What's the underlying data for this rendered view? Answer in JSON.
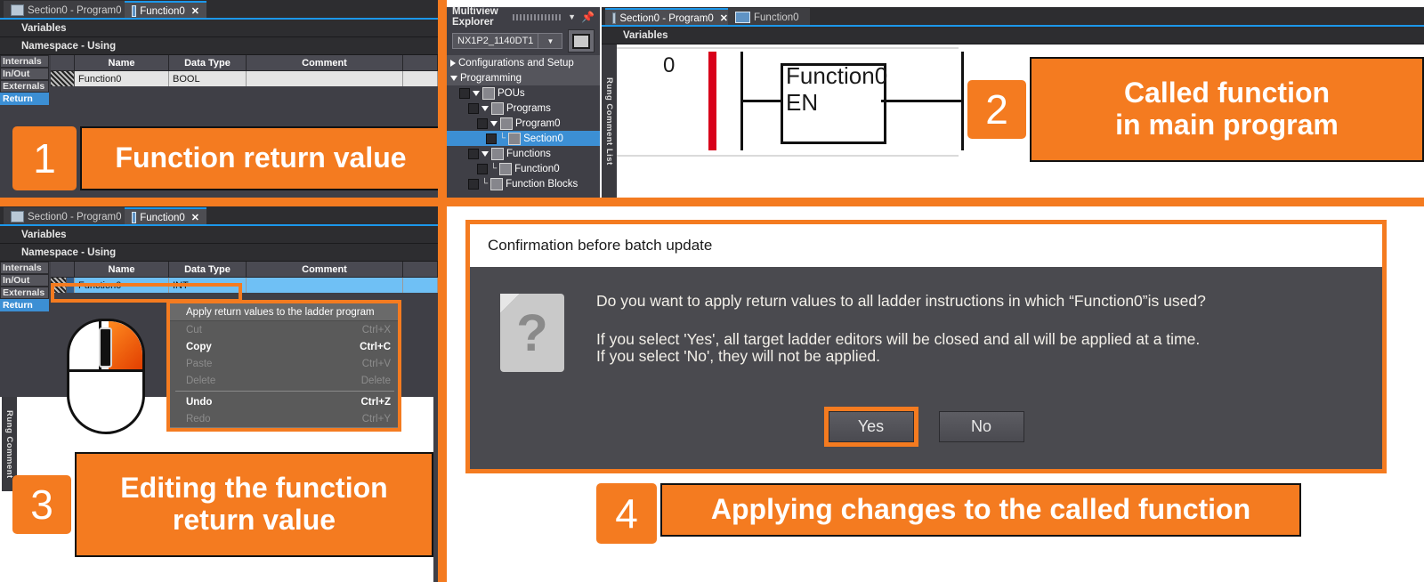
{
  "theme": {
    "accent": "#f47b20",
    "selection_blue": "#3c8fd4",
    "ide_background": "#3f3f46",
    "dialog_background": "#4a4a4f",
    "power_rail_red": "#d8001a"
  },
  "panel1": {
    "tabs": [
      {
        "label": "Section0 - Program0",
        "icon": "section-icon",
        "active": false,
        "closable": false
      },
      {
        "label": "Function0",
        "icon": "function-io-icon",
        "active": true,
        "closable": true,
        "close": "✕"
      }
    ],
    "bars": [
      {
        "label": "Variables"
      },
      {
        "label": "Namespace - Using"
      }
    ],
    "side_tabs": [
      {
        "label": "Internals",
        "selected": false
      },
      {
        "label": "In/Out",
        "selected": false
      },
      {
        "label": "Externals",
        "selected": false
      },
      {
        "label": "Return",
        "selected": true
      }
    ],
    "table": {
      "columns": [
        "",
        "Name",
        "Data Type",
        "Comment",
        ""
      ],
      "rows": [
        {
          "marker": "",
          "name": "Function0",
          "data_type": "BOOL",
          "comment": "",
          "extra": ""
        }
      ]
    }
  },
  "callout1": {
    "number": "1",
    "text": "Function return value"
  },
  "callout2": {
    "number": "2",
    "line1": "Called function",
    "line2": "in main program"
  },
  "callout3": {
    "number": "3",
    "line1": "Editing the function",
    "line2": "return value"
  },
  "callout4": {
    "number": "4",
    "text": "Applying changes to the called function"
  },
  "multiview": {
    "title": "Multiview Explorer",
    "icons": {
      "collapse": "chevron-down-icon",
      "pin": "pin-icon"
    },
    "device": "NX1P2_1140DT1",
    "device_dropdown_glyph": "▼",
    "tree": [
      {
        "label": "Configurations and Setup",
        "indent": 0,
        "expander": "right",
        "checkbox": false,
        "icon": false,
        "band": true,
        "selected": false,
        "elbow": false
      },
      {
        "label": "Programming",
        "indent": 0,
        "expander": "down",
        "checkbox": false,
        "icon": false,
        "band": true,
        "selected": false,
        "elbow": false
      },
      {
        "label": "POUs",
        "indent": 1,
        "expander": "down",
        "checkbox": true,
        "icon": true,
        "band": false,
        "selected": false,
        "elbow": false
      },
      {
        "label": "Programs",
        "indent": 2,
        "expander": "down",
        "checkbox": true,
        "icon": true,
        "band": false,
        "selected": false,
        "elbow": false
      },
      {
        "label": "Program0",
        "indent": 3,
        "expander": "down",
        "checkbox": true,
        "icon": true,
        "band": false,
        "selected": false,
        "elbow": false
      },
      {
        "label": "Section0",
        "indent": 4,
        "expander": "none",
        "checkbox": true,
        "icon": true,
        "band": false,
        "selected": true,
        "elbow": true
      },
      {
        "label": "Functions",
        "indent": 2,
        "expander": "down",
        "checkbox": true,
        "icon": true,
        "band": false,
        "selected": false,
        "elbow": false
      },
      {
        "label": "Function0",
        "indent": 3,
        "expander": "none",
        "checkbox": true,
        "icon": true,
        "band": false,
        "selected": false,
        "elbow": true
      },
      {
        "label": "Function Blocks",
        "indent": 2,
        "expander": "none",
        "checkbox": true,
        "icon": true,
        "band": false,
        "selected": false,
        "elbow": true
      }
    ]
  },
  "ladder_panel": {
    "tabs": [
      {
        "label": "Section0 - Program0",
        "icon": "section-icon",
        "active": true,
        "closable": true,
        "close": "✕"
      },
      {
        "label": "Function0",
        "icon": "function-io-icon",
        "active": false,
        "closable": false
      }
    ],
    "bar": "Variables",
    "rail_label": "Rung Comment List",
    "rung_number": "0",
    "instruction": {
      "name": "Function0",
      "input": "EN"
    }
  },
  "panel3": {
    "tabs": [
      {
        "label": "Section0 - Program0",
        "icon": "section-icon",
        "active": false,
        "closable": false
      },
      {
        "label": "Function0",
        "icon": "function-io-icon",
        "active": true,
        "closable": true,
        "close": "✕"
      }
    ],
    "bars": [
      {
        "label": "Variables"
      },
      {
        "label": "Namespace - Using"
      }
    ],
    "side_tabs": [
      {
        "label": "Internals",
        "selected": false
      },
      {
        "label": "In/Out",
        "selected": false
      },
      {
        "label": "Externals",
        "selected": false
      },
      {
        "label": "Return",
        "selected": true
      }
    ],
    "table": {
      "columns": [
        "",
        "Name",
        "Data Type",
        "Comment",
        ""
      ],
      "rows": [
        {
          "marker": "",
          "name": "Function0",
          "data_type": "INT",
          "comment": "",
          "extra": ""
        }
      ]
    },
    "rail_label": "Rung Comment",
    "mouse_hint": "right-click-highlighted"
  },
  "context_menu": {
    "header": "Apply return values to the ladder program",
    "items": [
      {
        "label": "Cut",
        "shortcut": "Ctrl+X",
        "enabled": false
      },
      {
        "label": "Copy",
        "shortcut": "Ctrl+C",
        "enabled": true
      },
      {
        "label": "Paste",
        "shortcut": "Ctrl+V",
        "enabled": false
      },
      {
        "label": "Delete",
        "shortcut": "Delete",
        "enabled": false
      },
      {
        "label": "Undo",
        "shortcut": "Ctrl+Z",
        "enabled": true
      },
      {
        "label": "Redo",
        "shortcut": "Ctrl+Y",
        "enabled": false
      }
    ]
  },
  "dialog": {
    "title": "Confirmation before batch update",
    "icon": "question-document-icon",
    "question": "Do you want to apply return values to all ladder instructions in which “Function0”is used?",
    "line2": "If you select 'Yes', all target ladder editors will be closed and all will be applied at a time.",
    "line3": "If you select 'No', they will not be applied.",
    "buttons": [
      {
        "label": "Yes",
        "highlighted": true
      },
      {
        "label": "No",
        "highlighted": false
      }
    ]
  }
}
